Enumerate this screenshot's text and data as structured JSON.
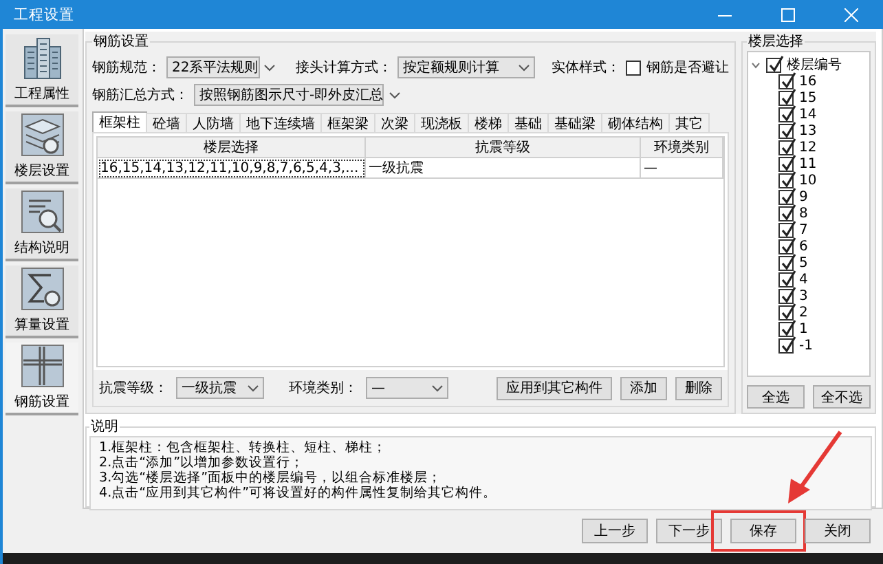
{
  "window": {
    "title": "工程设置"
  },
  "sidebar": {
    "items": [
      {
        "label": "工程属性",
        "selected": false
      },
      {
        "label": "楼层设置",
        "selected": false
      },
      {
        "label": "结构说明",
        "selected": false
      },
      {
        "label": "算量设置",
        "selected": false
      },
      {
        "label": "钢筋设置",
        "selected": true
      }
    ]
  },
  "rebar_settings": {
    "title": "钢筋设置",
    "code_label": "钢筋规范：",
    "code_value": "22系平法规则",
    "joint_label": "接头计算方式：",
    "joint_value": "按定额规则计算",
    "style_label": "实体样式：",
    "avoid": {
      "label": "钢筋是否避让",
      "checked": false
    },
    "summary_label": "钢筋汇总方式：",
    "summary_value": "按照钢筋图示尺寸-即外皮汇总",
    "tabs": [
      {
        "label": "框架柱",
        "selected": true
      },
      {
        "label": "砼墙",
        "selected": false
      },
      {
        "label": "人防墙",
        "selected": false
      },
      {
        "label": "地下连续墙",
        "selected": false
      },
      {
        "label": "框架梁",
        "selected": false
      },
      {
        "label": "次梁",
        "selected": false
      },
      {
        "label": "现浇板",
        "selected": false
      },
      {
        "label": "楼梯",
        "selected": false
      },
      {
        "label": "基础",
        "selected": false
      },
      {
        "label": "基础梁",
        "selected": false
      },
      {
        "label": "砌体结构",
        "selected": false
      },
      {
        "label": "其它",
        "selected": false
      }
    ],
    "table": {
      "columns": [
        "楼层选择",
        "抗震等级",
        "环境类别"
      ],
      "rows": [
        [
          "16,15,14,13,12,11,10,9,8,7,6,5,4,3,...",
          "一级抗震",
          "—"
        ]
      ]
    },
    "seismic_label": "抗震等级：",
    "seismic_value": "一级抗震",
    "env_label": "环境类别：",
    "env_value": "—",
    "buttons": [
      "应用到其它构件",
      "添加",
      "删除"
    ]
  },
  "floor_picker": {
    "title": "楼层选择",
    "root": {
      "label": "楼层编号",
      "checked": true,
      "expanded": true,
      "children": [
        {
          "label": "16",
          "checked": true
        },
        {
          "label": "15",
          "checked": true
        },
        {
          "label": "14",
          "checked": true
        },
        {
          "label": "13",
          "checked": true
        },
        {
          "label": "12",
          "checked": true
        },
        {
          "label": "11",
          "checked": true
        },
        {
          "label": "10",
          "checked": true
        },
        {
          "label": "9",
          "checked": true
        },
        {
          "label": "8",
          "checked": true
        },
        {
          "label": "7",
          "checked": true
        },
        {
          "label": "6",
          "checked": true
        },
        {
          "label": "5",
          "checked": true
        },
        {
          "label": "4",
          "checked": true
        },
        {
          "label": "3",
          "checked": true
        },
        {
          "label": "2",
          "checked": true
        },
        {
          "label": "1",
          "checked": true
        },
        {
          "label": "-1",
          "checked": true
        }
      ]
    },
    "buttons": [
      "全选",
      "全不选"
    ]
  },
  "notes": {
    "title": "说明",
    "lines": [
      "1.框架柱：包含框架柱、转换柱、短柱、梯柱；",
      "2.点击“添加”以增加参数设置行；",
      "3.勾选“楼层选择”面板中的楼层编号，以组合标准楼层；",
      "4.点击“应用到其它构件”可将设置好的构件属性复制给其它构件。"
    ]
  },
  "footer": {
    "buttons": [
      {
        "label": "上一步",
        "highlighted": false
      },
      {
        "label": "下一步",
        "highlighted": false
      },
      {
        "label": "保存",
        "highlighted": true
      },
      {
        "label": "关闭",
        "highlighted": false
      }
    ]
  }
}
